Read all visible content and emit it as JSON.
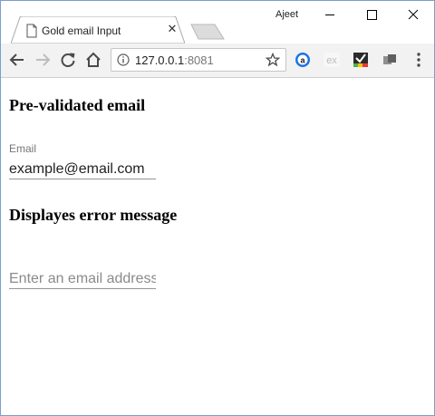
{
  "browser": {
    "tab_title": "Gold email Input",
    "tab_close_glyph": "✕",
    "profile_name": "Ajeet",
    "url_host": "127.0.0.1",
    "url_port": ":8081"
  },
  "icons": {
    "back": "back-arrow-icon",
    "forward": "forward-arrow-icon",
    "reload": "reload-icon",
    "home": "home-icon",
    "info": "info-icon",
    "bookmark": "star-icon",
    "menu": "kebab-menu-icon"
  },
  "extensions": [
    "amazon-assistant-icon",
    "ex-extension-icon",
    "checkbox-extension-icon",
    "cast-extension-icon"
  ],
  "page": {
    "heading_one": "Pre-validated email",
    "email_label": "Email",
    "email_value": "example@email.com",
    "heading_two": "Displayes error message",
    "email_placeholder": "Enter an email address"
  },
  "colors": {
    "accent_blue": "#1a73e8",
    "window_border": "#7a9fc9",
    "toolbar_bg": "#f2f2f2",
    "input_underline": "#949494"
  }
}
